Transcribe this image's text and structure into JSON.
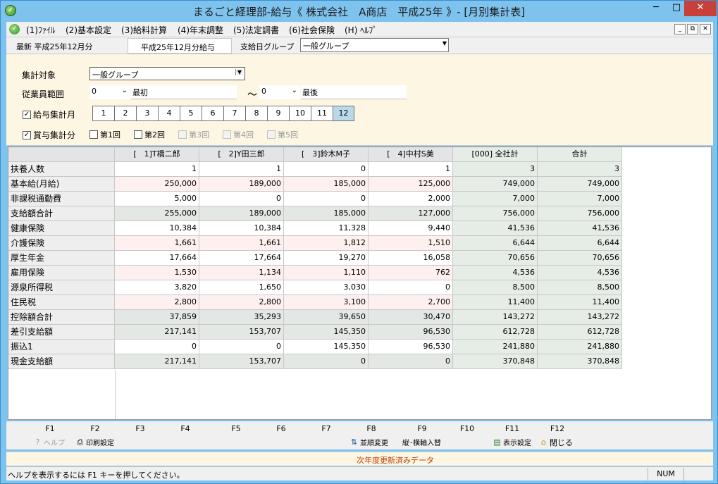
{
  "window": {
    "title": "まるごと経理部-給与《 株式会社　A商店　平成25年 》- [月別集計表]",
    "minimize": "─",
    "maximize": "□",
    "close": "✕"
  },
  "menu": {
    "items": [
      "(1)ﾌｧｲﾙ",
      "(2)基本設定",
      "(3)給料計算",
      "(4)年末調整",
      "(5)法定調書",
      "(6)社会保険",
      "(H) ﾍﾙﾌﾟ"
    ],
    "mdi": [
      "_",
      "⧉",
      "✕"
    ]
  },
  "infobar": {
    "latest": "最新 平成25年12月分",
    "period": "平成25年12月分給与",
    "group_label": "支給日グループ",
    "group_value": "一般グループ"
  },
  "filters": {
    "target_label": "集計対象",
    "target_value": "一般グループ",
    "range_label": "従業員範囲",
    "range_from_code": "0",
    "range_from_name": "最初",
    "tilde": "～",
    "range_to_code": "0",
    "range_to_name": "最後",
    "salary_label": "給与集計月",
    "months": [
      "1",
      "2",
      "3",
      "4",
      "5",
      "6",
      "7",
      "8",
      "9",
      "10",
      "11",
      "12"
    ],
    "bonus_label": "賞与集計分",
    "bonus_times": [
      "第1回",
      "第2回",
      "第3回",
      "第4回",
      "第5回"
    ]
  },
  "grid": {
    "columns": [
      "[　1]T橋二郎",
      "[　2]Y田三郎",
      "[　3]鈴木M子",
      "[　4]中村S美",
      "[000] 全社計",
      "合計"
    ],
    "rows": [
      {
        "label": "扶養人数",
        "values": [
          "1",
          "1",
          "0",
          "1",
          "3",
          "3"
        ],
        "tone": "white"
      },
      {
        "label": "基本給(月給)",
        "values": [
          "250,000",
          "189,000",
          "185,000",
          "125,000",
          "749,000",
          "749,000"
        ],
        "tone": "pink"
      },
      {
        "label": "非課税通勤費",
        "values": [
          "5,000",
          "0",
          "0",
          "2,000",
          "7,000",
          "7,000"
        ],
        "tone": "white"
      },
      {
        "label": "支給額合計",
        "values": [
          "255,000",
          "189,000",
          "185,000",
          "127,000",
          "756,000",
          "756,000"
        ],
        "tone": "gray"
      },
      {
        "label": "健康保険",
        "values": [
          "10,384",
          "10,384",
          "11,328",
          "9,440",
          "41,536",
          "41,536"
        ],
        "tone": "white"
      },
      {
        "label": "介護保険",
        "values": [
          "1,661",
          "1,661",
          "1,812",
          "1,510",
          "6,644",
          "6,644"
        ],
        "tone": "pink"
      },
      {
        "label": "厚生年金",
        "values": [
          "17,664",
          "17,664",
          "19,270",
          "16,058",
          "70,656",
          "70,656"
        ],
        "tone": "white"
      },
      {
        "label": "雇用保険",
        "values": [
          "1,530",
          "1,134",
          "1,110",
          "762",
          "4,536",
          "4,536"
        ],
        "tone": "pink"
      },
      {
        "label": "源泉所得税",
        "values": [
          "3,820",
          "1,650",
          "3,030",
          "0",
          "8,500",
          "8,500"
        ],
        "tone": "white"
      },
      {
        "label": "住民税",
        "values": [
          "2,800",
          "2,800",
          "3,100",
          "2,700",
          "11,400",
          "11,400"
        ],
        "tone": "pink"
      },
      {
        "label": "控除額合計",
        "values": [
          "37,859",
          "35,293",
          "39,650",
          "30,470",
          "143,272",
          "143,272"
        ],
        "tone": "gray"
      },
      {
        "label": "差引支給額",
        "values": [
          "217,141",
          "153,707",
          "145,350",
          "96,530",
          "612,728",
          "612,728"
        ],
        "tone": "gray"
      },
      {
        "label": "振込1",
        "values": [
          "0",
          "0",
          "145,350",
          "96,530",
          "241,880",
          "241,880"
        ],
        "tone": "white"
      },
      {
        "label": "現金支給額",
        "values": [
          "217,141",
          "153,707",
          "0",
          "0",
          "370,848",
          "370,848"
        ],
        "tone": "gray"
      }
    ]
  },
  "fkeys": {
    "keys": [
      "F1",
      "F2",
      "F3",
      "F4",
      "F5",
      "F6",
      "F7",
      "F8",
      "F9",
      "F10",
      "F11",
      "F12"
    ],
    "help": "ヘルプ",
    "print": "印刷設定",
    "sort": "並順変更",
    "axis": "縦･横軸入替",
    "display": "表示設定",
    "close": "閉じる"
  },
  "notice": "次年度更新済みデータ",
  "status": {
    "text": "ヘルプを表示するには F1 キーを押してください。",
    "num": "NUM"
  }
}
